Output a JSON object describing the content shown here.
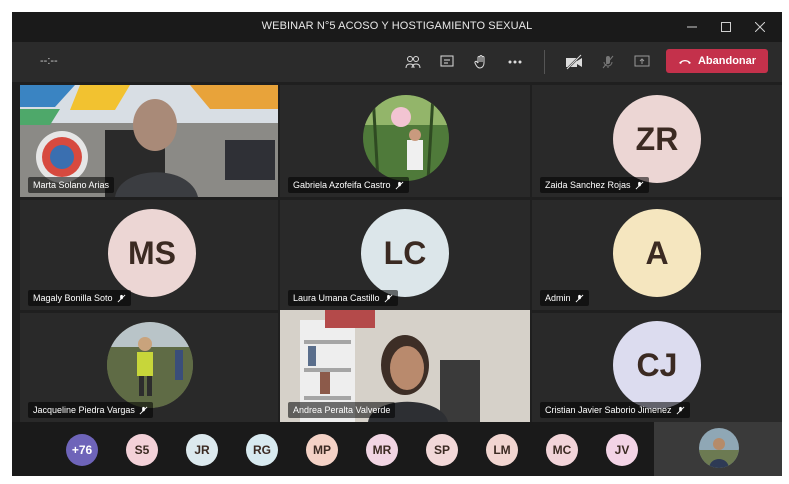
{
  "window": {
    "title": "WEBINAR N°5 ACOSO Y HOSTIGAMIENTO SEXUAL",
    "controls": [
      "minimize",
      "maximize",
      "close"
    ]
  },
  "toolbar": {
    "timer": "--:--",
    "icons": [
      "participants-icon",
      "chat-icon",
      "raise-hand-icon",
      "more-options-icon",
      "camera-off-icon",
      "mic-off-icon",
      "share-screen-icon"
    ],
    "leave_label": "Abandonar",
    "leave_color": "#c4314b"
  },
  "tiles": [
    {
      "name": "Marta Solano Arias",
      "type": "video"
    },
    {
      "name": "Gabriela Azofeifa Castro",
      "type": "photo"
    },
    {
      "name": "Zaida Sanchez Rojas",
      "type": "initials",
      "initials": "ZR",
      "color": "#ecd6d4"
    },
    {
      "name": "Magaly Bonilla Soto",
      "type": "initials",
      "initials": "MS",
      "color": "#ecd6d4"
    },
    {
      "name": "Laura Umana Castillo",
      "type": "initials",
      "initials": "LC",
      "color": "#dce6ea"
    },
    {
      "name": "Admin",
      "type": "initials",
      "initials": "A",
      "color": "#f5e6bf"
    },
    {
      "name": "Jacqueline Piedra Vargas",
      "type": "photo"
    },
    {
      "name": "Andrea Peralta Valverde",
      "type": "video"
    },
    {
      "name": "Cristian Javier Saborio Jimenez",
      "type": "initials",
      "initials": "CJ",
      "color": "#dcdcef"
    }
  ],
  "participants_bar": [
    {
      "label": "+76",
      "color": "#6e64b9"
    },
    {
      "label": "S5",
      "color": "#f3d1d8"
    },
    {
      "label": "JR",
      "color": "#dce9ee"
    },
    {
      "label": "RG",
      "color": "#d8eaf0"
    },
    {
      "label": "MP",
      "color": "#f4d2c6"
    },
    {
      "label": "MR",
      "color": "#f1d5e3"
    },
    {
      "label": "SP",
      "color": "#f2d8d8"
    },
    {
      "label": "LM",
      "color": "#f1d5d0"
    },
    {
      "label": "MC",
      "color": "#f2d4d9"
    },
    {
      "label": "JV",
      "color": "#f3d4e6"
    }
  ]
}
